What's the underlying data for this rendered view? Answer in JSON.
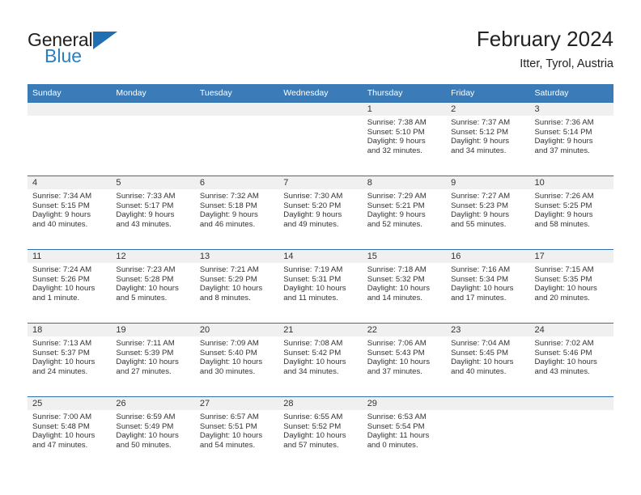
{
  "brand": {
    "name_top": "General",
    "name_bottom": "Blue",
    "triangle_icon": "blue-triangle-icon",
    "color_dark": "#231f20",
    "color_blue": "#2a7fc1"
  },
  "header": {
    "title": "February 2024",
    "subtitle": "Itter, Tyrol, Austria"
  },
  "theme": {
    "header_blue": "#3b7cb8",
    "rule_blue": "#2f6fae",
    "band_gray": "#f0f0f0",
    "text": "#333333"
  },
  "weekday_headers": [
    "Sunday",
    "Monday",
    "Tuesday",
    "Wednesday",
    "Thursday",
    "Friday",
    "Saturday"
  ],
  "weeks": [
    [
      {
        "day": "",
        "sunrise": "",
        "sunset": "",
        "daylight_1": "",
        "daylight_2": "",
        "empty": true
      },
      {
        "day": "",
        "sunrise": "",
        "sunset": "",
        "daylight_1": "",
        "daylight_2": "",
        "empty": true
      },
      {
        "day": "",
        "sunrise": "",
        "sunset": "",
        "daylight_1": "",
        "daylight_2": "",
        "empty": true
      },
      {
        "day": "",
        "sunrise": "",
        "sunset": "",
        "daylight_1": "",
        "daylight_2": "",
        "empty": true
      },
      {
        "day": "1",
        "sunrise": "Sunrise: 7:38 AM",
        "sunset": "Sunset: 5:10 PM",
        "daylight_1": "Daylight: 9 hours",
        "daylight_2": "and 32 minutes.",
        "empty": false
      },
      {
        "day": "2",
        "sunrise": "Sunrise: 7:37 AM",
        "sunset": "Sunset: 5:12 PM",
        "daylight_1": "Daylight: 9 hours",
        "daylight_2": "and 34 minutes.",
        "empty": false
      },
      {
        "day": "3",
        "sunrise": "Sunrise: 7:36 AM",
        "sunset": "Sunset: 5:14 PM",
        "daylight_1": "Daylight: 9 hours",
        "daylight_2": "and 37 minutes.",
        "empty": false
      }
    ],
    [
      {
        "day": "4",
        "sunrise": "Sunrise: 7:34 AM",
        "sunset": "Sunset: 5:15 PM",
        "daylight_1": "Daylight: 9 hours",
        "daylight_2": "and 40 minutes.",
        "empty": false
      },
      {
        "day": "5",
        "sunrise": "Sunrise: 7:33 AM",
        "sunset": "Sunset: 5:17 PM",
        "daylight_1": "Daylight: 9 hours",
        "daylight_2": "and 43 minutes.",
        "empty": false
      },
      {
        "day": "6",
        "sunrise": "Sunrise: 7:32 AM",
        "sunset": "Sunset: 5:18 PM",
        "daylight_1": "Daylight: 9 hours",
        "daylight_2": "and 46 minutes.",
        "empty": false
      },
      {
        "day": "7",
        "sunrise": "Sunrise: 7:30 AM",
        "sunset": "Sunset: 5:20 PM",
        "daylight_1": "Daylight: 9 hours",
        "daylight_2": "and 49 minutes.",
        "empty": false
      },
      {
        "day": "8",
        "sunrise": "Sunrise: 7:29 AM",
        "sunset": "Sunset: 5:21 PM",
        "daylight_1": "Daylight: 9 hours",
        "daylight_2": "and 52 minutes.",
        "empty": false
      },
      {
        "day": "9",
        "sunrise": "Sunrise: 7:27 AM",
        "sunset": "Sunset: 5:23 PM",
        "daylight_1": "Daylight: 9 hours",
        "daylight_2": "and 55 minutes.",
        "empty": false
      },
      {
        "day": "10",
        "sunrise": "Sunrise: 7:26 AM",
        "sunset": "Sunset: 5:25 PM",
        "daylight_1": "Daylight: 9 hours",
        "daylight_2": "and 58 minutes.",
        "empty": false
      }
    ],
    [
      {
        "day": "11",
        "sunrise": "Sunrise: 7:24 AM",
        "sunset": "Sunset: 5:26 PM",
        "daylight_1": "Daylight: 10 hours",
        "daylight_2": "and 1 minute.",
        "empty": false
      },
      {
        "day": "12",
        "sunrise": "Sunrise: 7:23 AM",
        "sunset": "Sunset: 5:28 PM",
        "daylight_1": "Daylight: 10 hours",
        "daylight_2": "and 5 minutes.",
        "empty": false
      },
      {
        "day": "13",
        "sunrise": "Sunrise: 7:21 AM",
        "sunset": "Sunset: 5:29 PM",
        "daylight_1": "Daylight: 10 hours",
        "daylight_2": "and 8 minutes.",
        "empty": false
      },
      {
        "day": "14",
        "sunrise": "Sunrise: 7:19 AM",
        "sunset": "Sunset: 5:31 PM",
        "daylight_1": "Daylight: 10 hours",
        "daylight_2": "and 11 minutes.",
        "empty": false
      },
      {
        "day": "15",
        "sunrise": "Sunrise: 7:18 AM",
        "sunset": "Sunset: 5:32 PM",
        "daylight_1": "Daylight: 10 hours",
        "daylight_2": "and 14 minutes.",
        "empty": false
      },
      {
        "day": "16",
        "sunrise": "Sunrise: 7:16 AM",
        "sunset": "Sunset: 5:34 PM",
        "daylight_1": "Daylight: 10 hours",
        "daylight_2": "and 17 minutes.",
        "empty": false
      },
      {
        "day": "17",
        "sunrise": "Sunrise: 7:15 AM",
        "sunset": "Sunset: 5:35 PM",
        "daylight_1": "Daylight: 10 hours",
        "daylight_2": "and 20 minutes.",
        "empty": false
      }
    ],
    [
      {
        "day": "18",
        "sunrise": "Sunrise: 7:13 AM",
        "sunset": "Sunset: 5:37 PM",
        "daylight_1": "Daylight: 10 hours",
        "daylight_2": "and 24 minutes.",
        "empty": false
      },
      {
        "day": "19",
        "sunrise": "Sunrise: 7:11 AM",
        "sunset": "Sunset: 5:39 PM",
        "daylight_1": "Daylight: 10 hours",
        "daylight_2": "and 27 minutes.",
        "empty": false
      },
      {
        "day": "20",
        "sunrise": "Sunrise: 7:09 AM",
        "sunset": "Sunset: 5:40 PM",
        "daylight_1": "Daylight: 10 hours",
        "daylight_2": "and 30 minutes.",
        "empty": false
      },
      {
        "day": "21",
        "sunrise": "Sunrise: 7:08 AM",
        "sunset": "Sunset: 5:42 PM",
        "daylight_1": "Daylight: 10 hours",
        "daylight_2": "and 34 minutes.",
        "empty": false
      },
      {
        "day": "22",
        "sunrise": "Sunrise: 7:06 AM",
        "sunset": "Sunset: 5:43 PM",
        "daylight_1": "Daylight: 10 hours",
        "daylight_2": "and 37 minutes.",
        "empty": false
      },
      {
        "day": "23",
        "sunrise": "Sunrise: 7:04 AM",
        "sunset": "Sunset: 5:45 PM",
        "daylight_1": "Daylight: 10 hours",
        "daylight_2": "and 40 minutes.",
        "empty": false
      },
      {
        "day": "24",
        "sunrise": "Sunrise: 7:02 AM",
        "sunset": "Sunset: 5:46 PM",
        "daylight_1": "Daylight: 10 hours",
        "daylight_2": "and 43 minutes.",
        "empty": false
      }
    ],
    [
      {
        "day": "25",
        "sunrise": "Sunrise: 7:00 AM",
        "sunset": "Sunset: 5:48 PM",
        "daylight_1": "Daylight: 10 hours",
        "daylight_2": "and 47 minutes.",
        "empty": false
      },
      {
        "day": "26",
        "sunrise": "Sunrise: 6:59 AM",
        "sunset": "Sunset: 5:49 PM",
        "daylight_1": "Daylight: 10 hours",
        "daylight_2": "and 50 minutes.",
        "empty": false
      },
      {
        "day": "27",
        "sunrise": "Sunrise: 6:57 AM",
        "sunset": "Sunset: 5:51 PM",
        "daylight_1": "Daylight: 10 hours",
        "daylight_2": "and 54 minutes.",
        "empty": false
      },
      {
        "day": "28",
        "sunrise": "Sunrise: 6:55 AM",
        "sunset": "Sunset: 5:52 PM",
        "daylight_1": "Daylight: 10 hours",
        "daylight_2": "and 57 minutes.",
        "empty": false
      },
      {
        "day": "29",
        "sunrise": "Sunrise: 6:53 AM",
        "sunset": "Sunset: 5:54 PM",
        "daylight_1": "Daylight: 11 hours",
        "daylight_2": "and 0 minutes.",
        "empty": false
      },
      {
        "day": "",
        "sunrise": "",
        "sunset": "",
        "daylight_1": "",
        "daylight_2": "",
        "empty": true
      },
      {
        "day": "",
        "sunrise": "",
        "sunset": "",
        "daylight_1": "",
        "daylight_2": "",
        "empty": true
      }
    ]
  ]
}
